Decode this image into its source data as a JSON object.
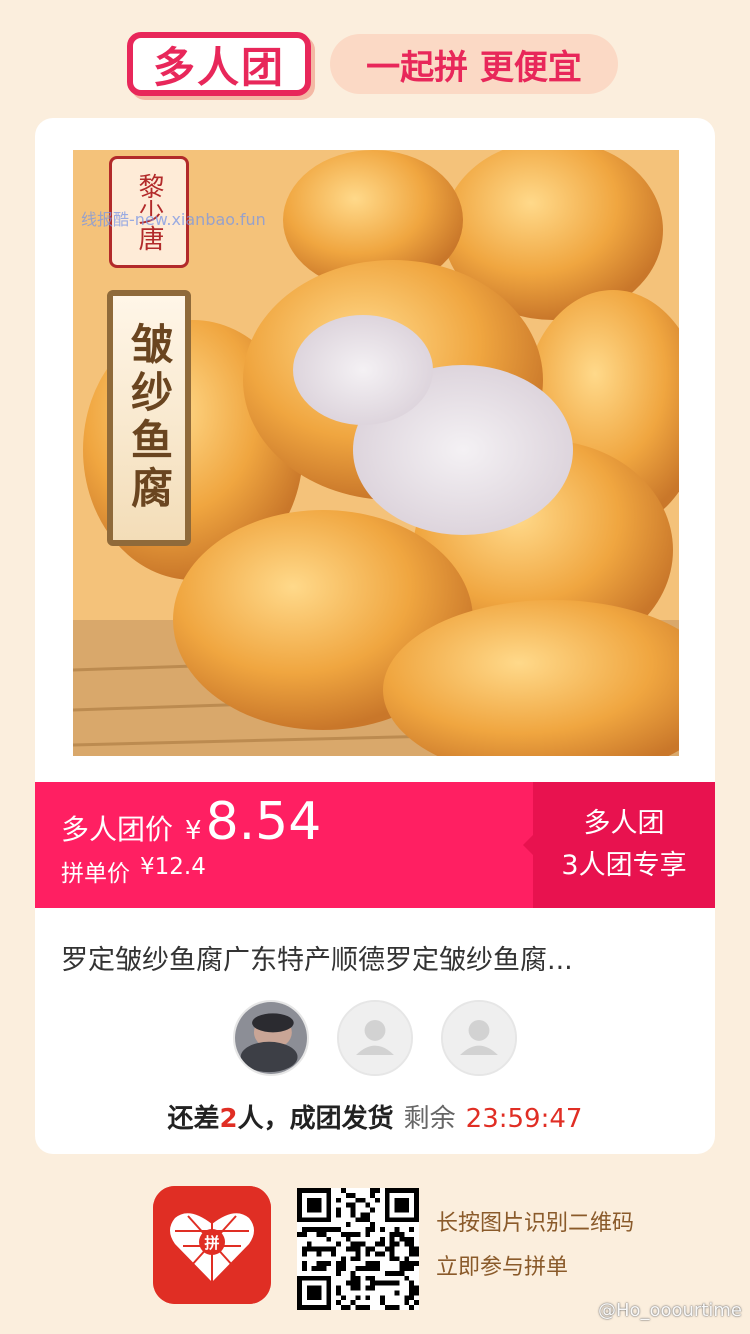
{
  "header": {
    "badge": "多人团",
    "slogan": "一起拼 更便宜"
  },
  "product": {
    "brand_seal": "黎少唐",
    "watermark": "线报酷-new.xianbao.fun",
    "image_label": "皱纱鱼腐",
    "title": "罗定皱纱鱼腐广东特产顺德罗定皱纱鱼腐..."
  },
  "price_bar": {
    "group_price_label": "多人团价",
    "currency": "¥",
    "group_price": "8.54",
    "single_price_label": "拼单价",
    "single_price": "¥12.4",
    "badge_line1": "多人团",
    "badge_line2": "3人团专享"
  },
  "status": {
    "prefix": "还差",
    "count": "2",
    "suffix": "人，成团发货",
    "remaining_label": "剩余",
    "timer": "23:59:47"
  },
  "footer": {
    "line1": "长按图片识别二维码",
    "line2": "立即参与拼单",
    "credit": "@Ho_ooourtime"
  },
  "colors": {
    "accent": "#ff1f62",
    "accent_dark": "#e8124f",
    "timer": "#e02e24",
    "background": "#fbeedd"
  }
}
